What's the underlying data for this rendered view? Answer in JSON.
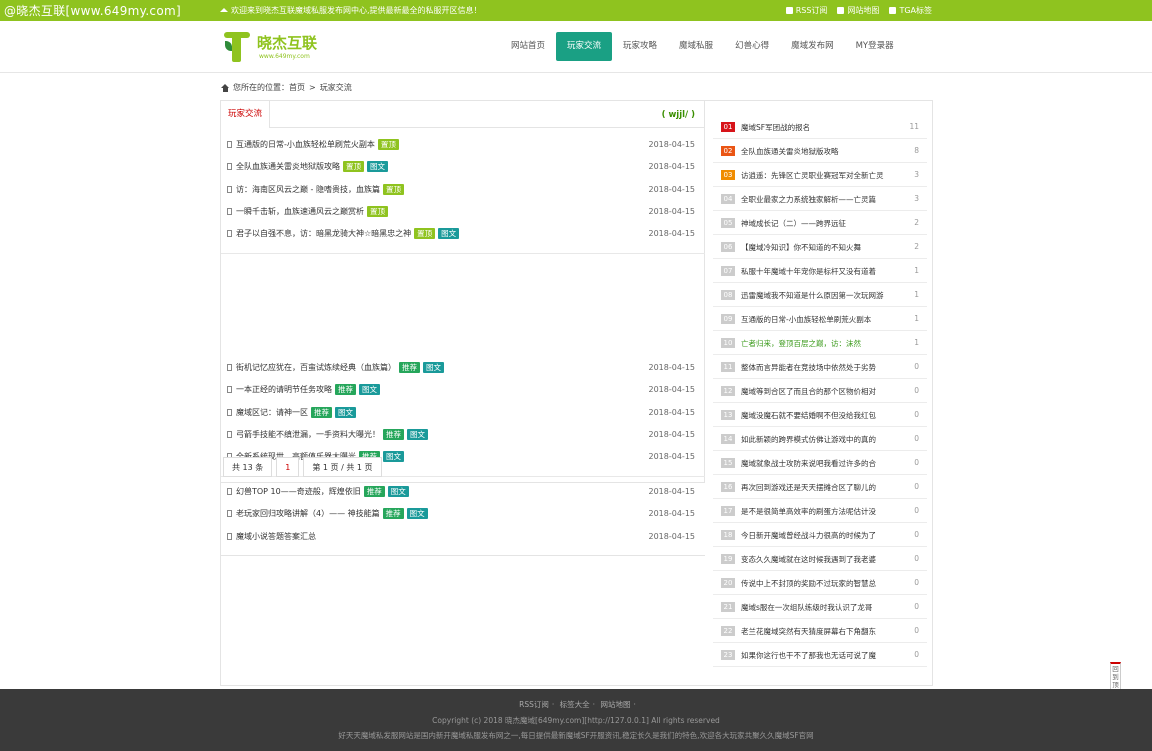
{
  "topbar": {
    "site_text": "@晓杰互联[www.649my.com]",
    "welcome": "欢迎来到晓杰互联魔域私服发布网中心,提供最新最全的私服开区信息！",
    "links": [
      "RSS订阅",
      "网站地图",
      "TGA标签"
    ]
  },
  "header": {
    "logo_title": "晓杰互联",
    "logo_sub": "www.649my.com",
    "nav": [
      "网站首页",
      "玩家交流",
      "玩家攻略",
      "魔域私服",
      "幻兽心得",
      "魔域发布网",
      "MY登录器"
    ],
    "active_nav": "玩家交流"
  },
  "breadcrumb": {
    "prefix": "您所在的位置：",
    "home": "首页",
    "sep": ">",
    "current": "玩家交流"
  },
  "panel": {
    "tab": "玩家交流",
    "extra": "( wjjl/ )"
  },
  "groups": [
    [
      {
        "title": "互通版的日常-小血族轻松单刷荒火副本",
        "badges": [
          "置顶"
        ],
        "date": "2018-04-15"
      },
      {
        "title": "全队血族通关雷炎地狱版攻略",
        "badges": [
          "置顶",
          "图文"
        ],
        "date": "2018-04-15"
      },
      {
        "title": "访：海南区风云之巅 - 隐嗜贵技，血族篇",
        "badges": [
          "置顶"
        ],
        "date": "2018-04-15"
      },
      {
        "title": "一瞬千击斩，血族速通风云之巅赏析",
        "badges": [
          "置顶"
        ],
        "date": "2018-04-15"
      },
      {
        "title": "君子以自强不息，访：暗黑龙骑大神☆暗黑忠之神",
        "badges": [
          "置顶",
          "图文"
        ],
        "date": "2018-04-15"
      }
    ],
    [
      {
        "title": "街机记忆应犹在，百蛮试炼续经典（血族篇）",
        "badges": [
          "推荐",
          "图文"
        ],
        "date": "2018-04-15"
      },
      {
        "title": "一本正经的请明节任务攻略",
        "badges": [
          "推荐",
          "图文"
        ],
        "date": "2018-04-15"
      },
      {
        "title": "魔域区记：请神一区",
        "badges": [
          "推荐",
          "图文"
        ],
        "date": "2018-04-15"
      },
      {
        "title": "弓箭手技能不缜泄漏，一手资料大曝光！",
        "badges": [
          "推荐",
          "图文"
        ],
        "date": "2018-04-15"
      },
      {
        "title": "全新系统现世，高额值乐器大曝光",
        "badges": [
          "推荐",
          "图文"
        ],
        "date": "2018-04-15"
      }
    ],
    [
      {
        "title": "幻兽TOP 10——奇迹般，辉煌依旧",
        "badges": [
          "推荐",
          "图文"
        ],
        "date": "2018-04-15"
      },
      {
        "title": "老玩家回归攻略讲解（4）—— 神技能篇",
        "badges": [
          "推荐",
          "图文"
        ],
        "date": "2018-04-15"
      },
      {
        "title": "魔域小说答题答案汇总",
        "badges": [],
        "date": "2018-04-15"
      }
    ]
  ],
  "pager": {
    "total": "共 13 条",
    "current": "1",
    "pages": "第 1 页 / 共 1 页"
  },
  "ranking": [
    {
      "num": "01",
      "title": "魔域SF军团战的报名",
      "count": "11"
    },
    {
      "num": "02",
      "title": "全队血族通关雷炎地狱版攻略",
      "count": "8"
    },
    {
      "num": "03",
      "title": "访逍遥：先锋区亡灵职业赛冠军对全新亡灵",
      "count": "3"
    },
    {
      "num": "04",
      "title": "全职业最家之力系统独家解析——亡灵篇",
      "count": "3"
    },
    {
      "num": "05",
      "title": "神域成长记（二）——跨界远征",
      "count": "2"
    },
    {
      "num": "06",
      "title": "【魔域冷知识】你不知道的不知火舞",
      "count": "2"
    },
    {
      "num": "07",
      "title": "私服十年魔域十年宠你是标杆又没有道着",
      "count": "1"
    },
    {
      "num": "08",
      "title": "迅雷魔域我不知道是什么原因第一次玩网游",
      "count": "1"
    },
    {
      "num": "09",
      "title": "互通版的日常-小血族轻松单刷荒火副本",
      "count": "1"
    },
    {
      "num": "10",
      "title": "亡者归来，登顶百层之巅，访：沫然",
      "count": "1"
    },
    {
      "num": "11",
      "title": "整体而言异能者在竞技场中依然处于劣势",
      "count": "0"
    },
    {
      "num": "12",
      "title": "魔域等到合区了而且合的那个区物价相对",
      "count": "0"
    },
    {
      "num": "13",
      "title": "魔域没魔石就不要结婚啊不但没给我红包",
      "count": "0"
    },
    {
      "num": "14",
      "title": "如此新颖的跨界模式仿佛让游戏中的真的",
      "count": "0"
    },
    {
      "num": "15",
      "title": "魔域就象战士攻防来说吧我看过许多的合",
      "count": "0"
    },
    {
      "num": "16",
      "title": "再次回到游戏还是天天摆摊合区了聊儿的",
      "count": "0"
    },
    {
      "num": "17",
      "title": "是不是很简单高效率的刷蛋方法呢估计没",
      "count": "0"
    },
    {
      "num": "18",
      "title": "今日新开魔域曾经战斗力很高的时候为了",
      "count": "0"
    },
    {
      "num": "19",
      "title": "变态久久魔域就在这时候我遇到了我老婆",
      "count": "0"
    },
    {
      "num": "20",
      "title": "传说中上不封顶的奖励不过玩家的智慧总",
      "count": "0"
    },
    {
      "num": "21",
      "title": "魔域s服在一次组队练级时我认识了龙哥",
      "count": "0"
    },
    {
      "num": "22",
      "title": "老兰花魔域突然有天猜度屏幕右下角翻东",
      "count": "0"
    },
    {
      "num": "23",
      "title": "如果你这行也干不了那我也无话可说了魔",
      "count": "0"
    }
  ],
  "backtop": "回到顶部",
  "footer": {
    "links": [
      "RSS订阅",
      "标签大全",
      "网站地图"
    ],
    "copyright": "Copyright (c) 2018 晓杰魔域[649my.com][http://127.0.0.1] All rights reserved",
    "desc": "好天天魔域私发服网站是国内新开魔域私服发布网之一,每日提供最新魔域SF开服资讯,稳定长久是我们的特色,欢迎各大玩家共聚久久魔域SF官网"
  }
}
